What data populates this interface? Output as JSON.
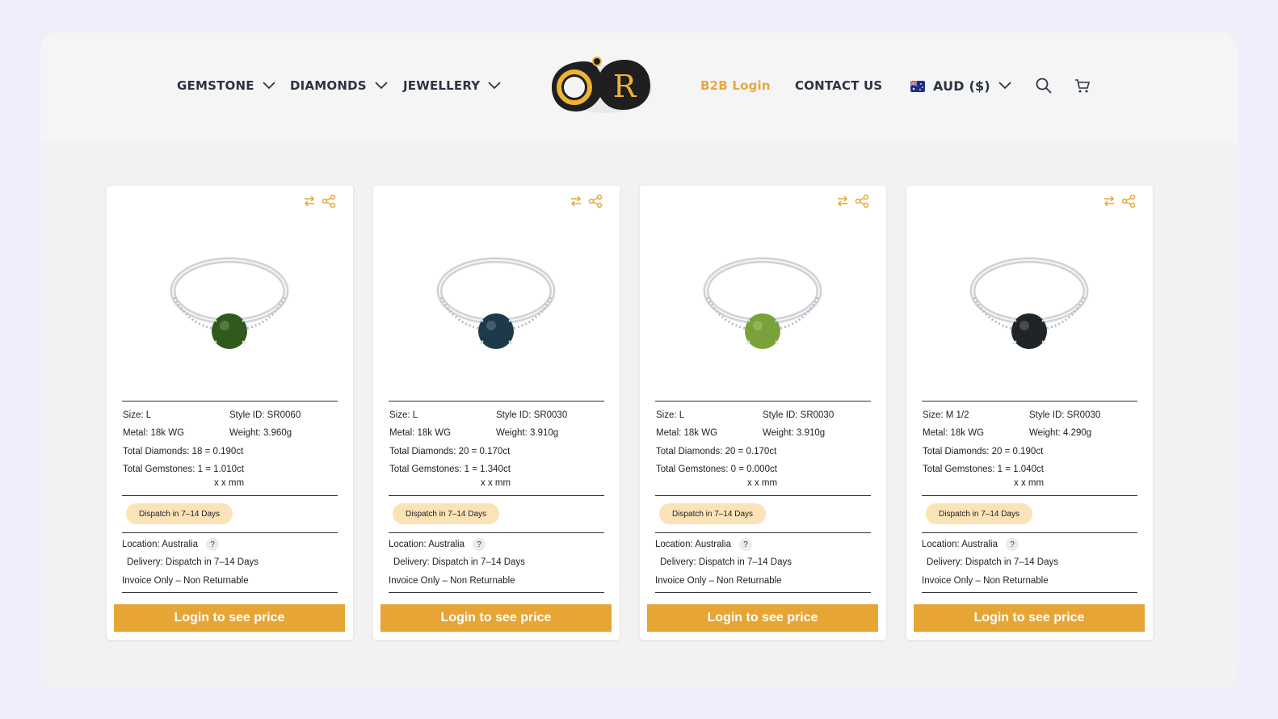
{
  "nav": {
    "gemstone": "GEMSTONE",
    "diamonds": "DIAMONDS",
    "jewellery": "JEWELLERY",
    "logo_letter": "R",
    "b2b_login": "B2B Login",
    "contact_us": "CONTACT US",
    "currency": "AUD ($)"
  },
  "colors": {
    "accent": "#e6a534",
    "badge": "#fbe3b7",
    "nav_text": "#2b3443"
  },
  "products": [
    {
      "size": "Size: L",
      "style_id": "Style ID: SR0060",
      "metal": "Metal: 18k WG",
      "weight": "Weight: 3.960g",
      "total_diamonds": "Total Diamonds: 18 = 0.190ct",
      "total_gemstones": "Total Gemstones: 1 = 1.010ct",
      "dimensions": "x x mm",
      "badge": "Dispatch in 7–14 Days",
      "location": "Location: Australia",
      "delivery": "Delivery:  Dispatch in 7–14 Days",
      "invoice": "Invoice Only – Non Returnable",
      "button": "Login to see price",
      "stone_color": "#2f5a1c"
    },
    {
      "size": "Size: L",
      "style_id": "Style ID: SR0030",
      "metal": "Metal: 18k WG",
      "weight": "Weight: 3.910g",
      "total_diamonds": "Total Diamonds: 20 = 0.170ct",
      "total_gemstones": "Total Gemstones: 1 = 1.340ct",
      "dimensions": "x x mm",
      "badge": "Dispatch in 7–14 Days",
      "location": "Location: Australia",
      "delivery": "Delivery:  Dispatch in 7–14 Days",
      "invoice": "Invoice Only – Non Returnable",
      "button": "Login to see price",
      "stone_color": "#1d3a4a"
    },
    {
      "size": "Size: L",
      "style_id": "Style ID: SR0030",
      "metal": "Metal: 18k WG",
      "weight": "Weight: 3.910g",
      "total_diamonds": "Total Diamonds: 20 = 0.170ct",
      "total_gemstones": "Total Gemstones: 0 = 0.000ct",
      "dimensions": "x x mm",
      "badge": "Dispatch in 7–14 Days",
      "location": "Location: Australia",
      "delivery": "Delivery:  Dispatch in 7–14 Days",
      "invoice": "Invoice Only – Non Returnable",
      "button": "Login to see price",
      "stone_color": "#7aa23a"
    },
    {
      "size": "Size: M 1/2",
      "style_id": "Style ID: SR0030",
      "metal": "Metal: 18k WG",
      "weight": "Weight: 4.290g",
      "total_diamonds": "Total Diamonds: 20 = 0.190ct",
      "total_gemstones": "Total Gemstones: 1 = 1.040ct",
      "dimensions": "x x mm",
      "badge": "Dispatch in 7–14 Days",
      "location": "Location: Australia",
      "delivery": "Delivery:  Dispatch in 7–14 Days",
      "invoice": "Invoice Only – Non Returnable",
      "button": "Login to see price",
      "stone_color": "#1e2428"
    }
  ]
}
